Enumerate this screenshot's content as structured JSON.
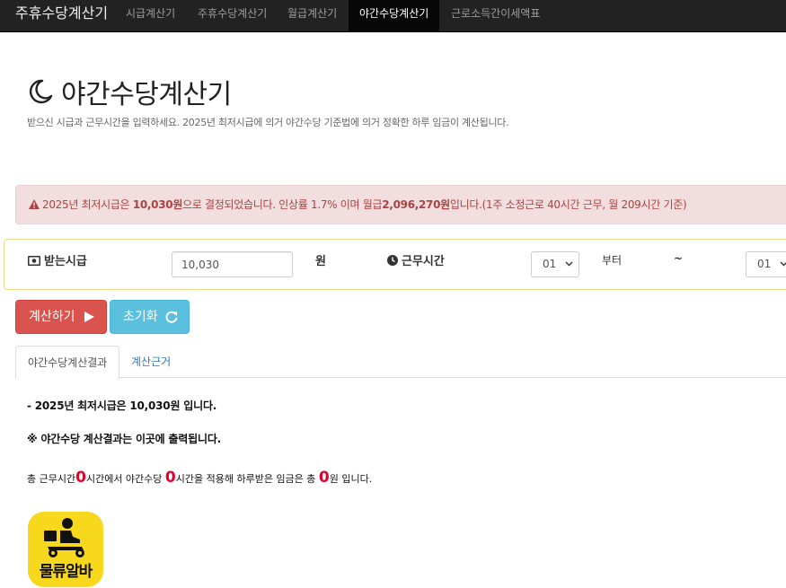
{
  "navbar": {
    "brand": "주휴수당계산기",
    "items": [
      {
        "label": "시급계산기"
      },
      {
        "label": "주휴수당계산기"
      },
      {
        "label": "월급계산기"
      },
      {
        "label": "야간수당계산기",
        "active": true
      },
      {
        "label": "근로소득간이세액표"
      }
    ]
  },
  "header": {
    "title": "야간수당계산기",
    "subtitle": "받으신 시급과 근무시간을 입력하세요. 2025년 최저시급에 의거 야간수당 기준법에 의거 정확한 하루 임금이 계산됩니다."
  },
  "alert": {
    "prefix": "2025년 최저시급은 ",
    "wage": "10,030원",
    "middle": "으로 결정되었습니다. 인상률 1.7% 이며 월급",
    "monthly": "2,096,270원",
    "suffix": "입니다.(1주 소정근로 40시간 근무, 월 209시간 기준)"
  },
  "form": {
    "wage_label": "받는시급",
    "wage_value": "10,030",
    "wage_unit": "원",
    "hours_label": "근무시간",
    "start_value": "01",
    "from_label": "부터",
    "tilde": "~",
    "end_value": "01"
  },
  "buttons": {
    "calc": "계산하기",
    "reset": "초기화"
  },
  "tabs": {
    "result": "야간수당계산결과",
    "basis": "계산근거"
  },
  "results": {
    "min_wage_line": "- 2025년 최저시급은 10,030원 입니다.",
    "notice": "※ 야간수당 계산결과는 이곳에 출력됩니다.",
    "sum_prefix": "총 근무시간",
    "total_hours": "0",
    "sum_mid1": "시간에서 야간수당 ",
    "night_hours": "0",
    "sum_mid2": "시간을 적용해 하루받은 임금은 총 ",
    "total_pay": "0",
    "sum_suffix": "원 입니다."
  },
  "logo": {
    "text": "물류알바"
  },
  "colors": {
    "navbar": "#222222",
    "alert_bg": "#f2dede",
    "alert_text": "#a94442",
    "calc_button": "#d9534f",
    "reset_button": "#5bc0de",
    "highlight": "#e4002b",
    "logo_bg": "#f8d81c"
  }
}
